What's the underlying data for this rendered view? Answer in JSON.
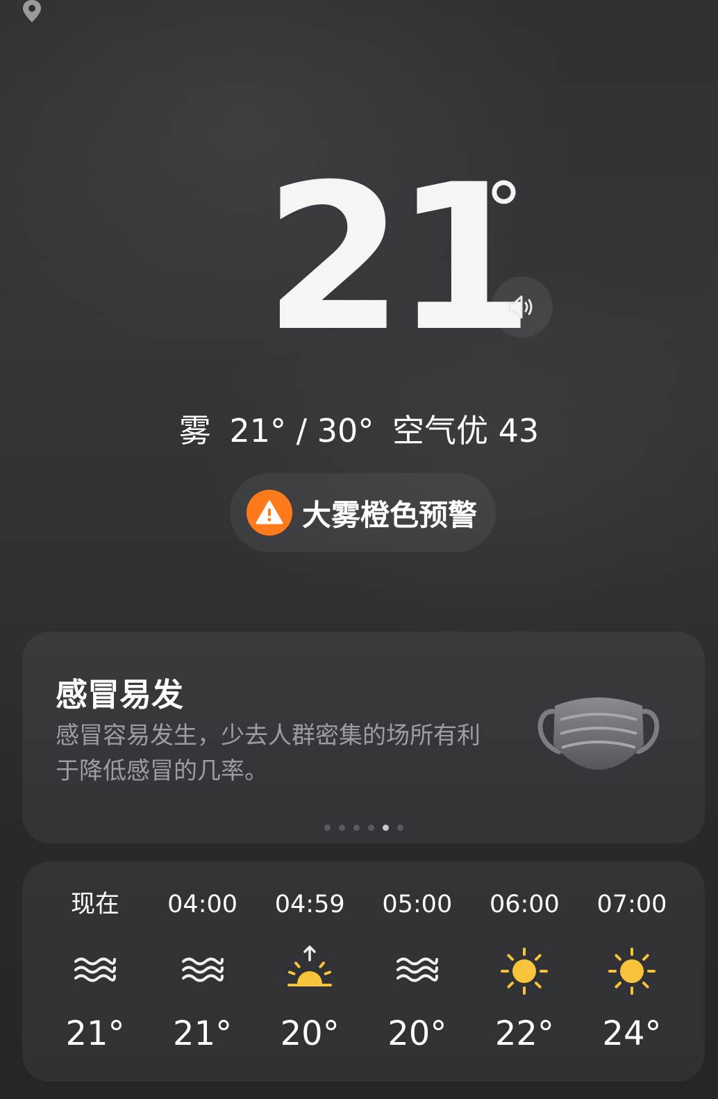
{
  "current": {
    "temperature": "21",
    "degree_symbol": "°",
    "summary": {
      "condition": "雾",
      "range": "21° / 30°",
      "air_quality": "空气优 43"
    }
  },
  "alert": {
    "label": "大雾橙色预警",
    "color": "#ff7a1a"
  },
  "tip_card": {
    "title": "感冒易发",
    "description": "感冒容易发生，少去人群密集的场所有利于降低感冒的几率。",
    "page_count": 6,
    "active_page": 5
  },
  "hourly": [
    {
      "time": "现在",
      "icon": "fog-icon",
      "temp": "21°"
    },
    {
      "time": "04:00",
      "icon": "fog-icon",
      "temp": "21°"
    },
    {
      "time": "04:59",
      "icon": "sunrise-icon",
      "temp": "20°"
    },
    {
      "time": "05:00",
      "icon": "fog-icon",
      "temp": "20°"
    },
    {
      "time": "06:00",
      "icon": "sun-icon",
      "temp": "22°"
    },
    {
      "time": "07:00",
      "icon": "sun-icon",
      "temp": "24°"
    }
  ],
  "colors": {
    "sun": "#f6c33a",
    "alert": "#ff7a1a",
    "muted_text": "#9c9ea3"
  }
}
